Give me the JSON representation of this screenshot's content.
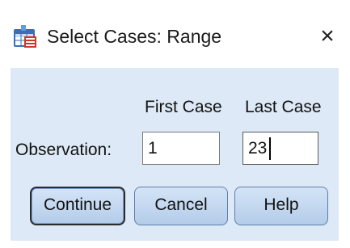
{
  "window": {
    "title": "Select Cases: Range",
    "close_glyph": "×",
    "app_icon": "spss-table-icon"
  },
  "columns": {
    "first_case": "First Case",
    "last_case": "Last Case"
  },
  "row": {
    "label": "Observation:"
  },
  "fields": {
    "first_case_value": "1",
    "last_case_value": "23"
  },
  "buttons": {
    "continue": "Continue",
    "cancel": "Cancel",
    "help": "Help"
  },
  "colors": {
    "panel_background": "#dde9f6",
    "button_gradient_top": "#d4e4f7",
    "button_gradient_bottom": "#b4cce9"
  }
}
